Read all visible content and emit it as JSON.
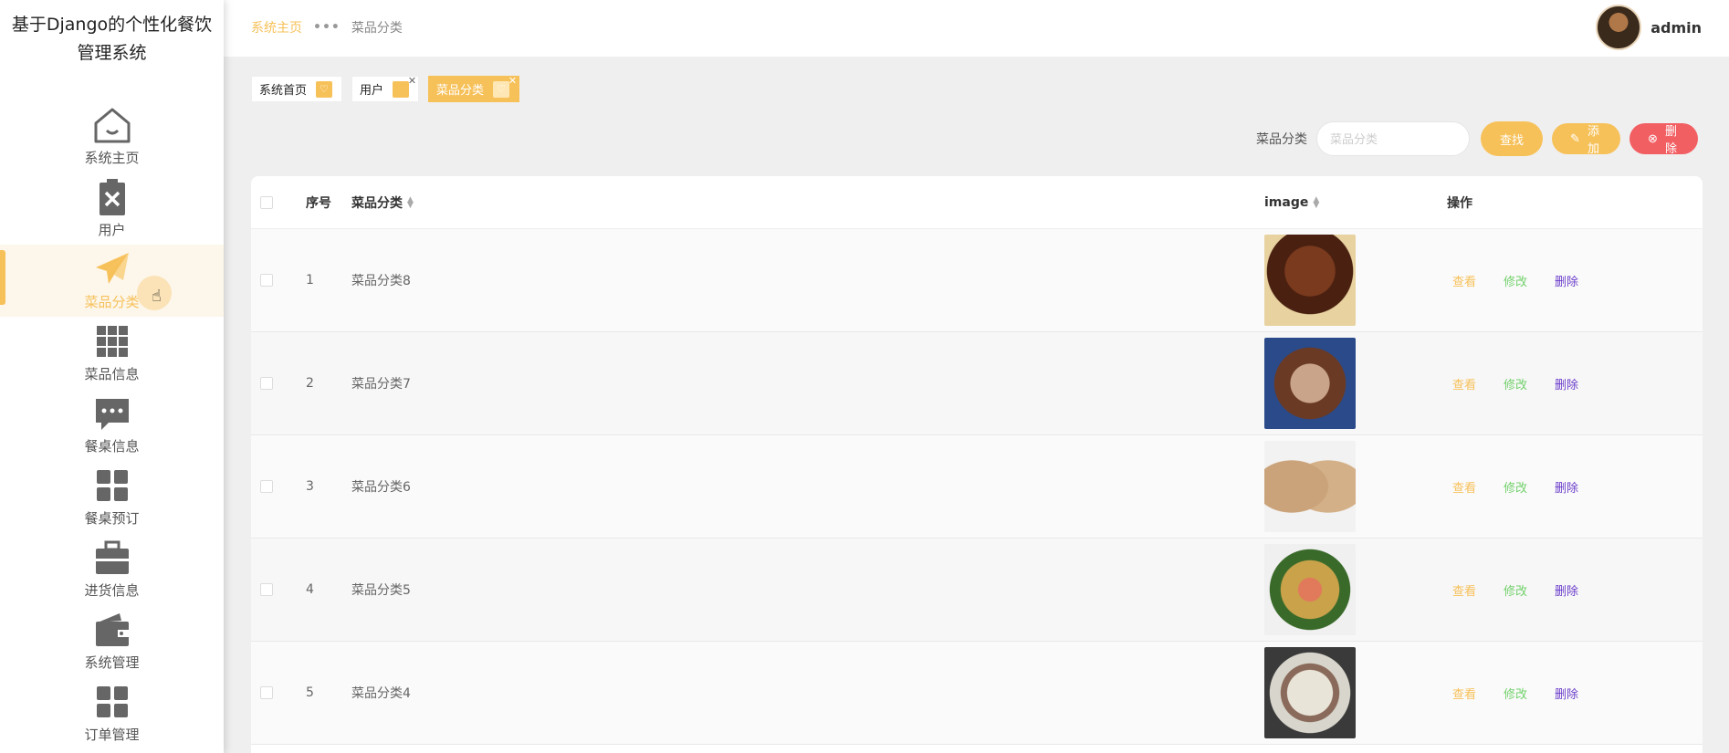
{
  "app": {
    "title_line1": "基于Django的个性化餐饮",
    "title_line2": "管理系统"
  },
  "sidebar": {
    "items": [
      {
        "label": "系统主页",
        "icon": "home-icon"
      },
      {
        "label": "用户",
        "icon": "clipboard-x-icon"
      },
      {
        "label": "菜品分类",
        "icon": "paper-plane-icon"
      },
      {
        "label": "菜品信息",
        "icon": "grid-icon"
      },
      {
        "label": "餐桌信息",
        "icon": "chat-bubble-icon"
      },
      {
        "label": "餐桌预订",
        "icon": "four-squares-icon"
      },
      {
        "label": "进货信息",
        "icon": "briefcase-icon"
      },
      {
        "label": "系统管理",
        "icon": "wallet-icon"
      },
      {
        "label": "订单管理",
        "icon": "four-squares-icon"
      }
    ],
    "active_index": 2
  },
  "header": {
    "breadcrumb_home": "系统主页",
    "breadcrumb_current": "菜品分类",
    "username": "admin"
  },
  "tabs": [
    {
      "label": "系统首页",
      "closable": false,
      "active": false
    },
    {
      "label": "用户",
      "closable": true,
      "active": false
    },
    {
      "label": "菜品分类",
      "closable": true,
      "active": true
    }
  ],
  "search": {
    "label": "菜品分类",
    "placeholder": "菜品分类",
    "find_label": "查找",
    "add_label": "添加",
    "delete_label": "删除"
  },
  "table": {
    "columns": {
      "index": "序号",
      "name": "菜品分类",
      "image": "image",
      "ops": "操作"
    },
    "ops": {
      "view": "查看",
      "edit": "修改",
      "delete": "删除"
    },
    "rows": [
      {
        "index": "1",
        "name": "菜品分类8"
      },
      {
        "index": "2",
        "name": "菜品分类7"
      },
      {
        "index": "3",
        "name": "菜品分类6"
      },
      {
        "index": "4",
        "name": "菜品分类5"
      },
      {
        "index": "5",
        "name": "菜品分类4"
      }
    ]
  },
  "colors": {
    "accent": "#f7c15a",
    "danger": "#f25f63",
    "edit": "#72d16b",
    "delete_link": "#6b3dcb"
  }
}
